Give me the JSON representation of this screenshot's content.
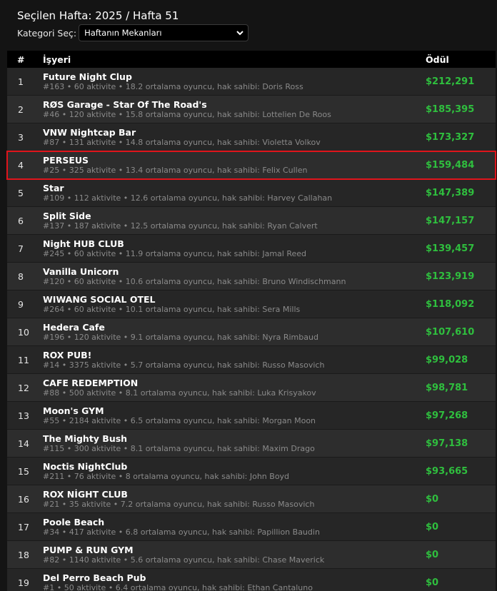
{
  "header": {
    "week_title": "Seçilen Hafta: 2025 / Hafta 51",
    "category_label": "Kategori Seç:",
    "category_selected": "Haftanın Mekanları"
  },
  "table": {
    "columns": {
      "rank": "#",
      "business": "İşyeri",
      "prize": "Ödül"
    },
    "highlight_color": "#e0141b",
    "prize_color": "#2fbf3e",
    "rows": [
      {
        "rank": "1",
        "name": "Future Night Clup",
        "meta": "#163 • 60 aktivite • 18.2 ortalama oyuncu, hak sahibi: Doris Ross",
        "prize": "$212,291"
      },
      {
        "rank": "2",
        "name": "RØS Garage - Star Of The Road's",
        "meta": "#46 • 120 aktivite • 15.8 ortalama oyuncu, hak sahibi: Lottelien De Roos",
        "prize": "$185,395"
      },
      {
        "rank": "3",
        "name": "VNW Nightcap Bar",
        "meta": "#87 • 131 aktivite • 14.8 ortalama oyuncu, hak sahibi: Violetta Volkov",
        "prize": "$173,327"
      },
      {
        "rank": "4",
        "name": "PERSEUS",
        "meta": "#25 • 325 aktivite • 13.4 ortalama oyuncu, hak sahibi: Felix Cullen",
        "prize": "$159,484"
      },
      {
        "rank": "5",
        "name": "Star",
        "meta": "#109 • 112 aktivite • 12.6 ortalama oyuncu, hak sahibi: Harvey Callahan",
        "prize": "$147,389"
      },
      {
        "rank": "6",
        "name": "Split Side",
        "meta": "#137 • 187 aktivite • 12.5 ortalama oyuncu, hak sahibi: Ryan Calvert",
        "prize": "$147,157"
      },
      {
        "rank": "7",
        "name": "Night HUB CLUB",
        "meta": "#245 • 60 aktivite • 11.9 ortalama oyuncu, hak sahibi: Jamal Reed",
        "prize": "$139,457"
      },
      {
        "rank": "8",
        "name": "Vanilla Unicorn",
        "meta": "#120 • 60 aktivite • 10.6 ortalama oyuncu, hak sahibi: Bruno Windischmann",
        "prize": "$123,919"
      },
      {
        "rank": "9",
        "name": "WIWANG SOCIAL OTEL",
        "meta": "#264 • 60 aktivite • 10.1 ortalama oyuncu, hak sahibi: Sera Mills",
        "prize": "$118,092"
      },
      {
        "rank": "10",
        "name": "Hedera Cafe",
        "meta": "#196 • 120 aktivite • 9.1 ortalama oyuncu, hak sahibi: Nyra Rimbaud",
        "prize": "$107,610"
      },
      {
        "rank": "11",
        "name": "ROX PUB!",
        "meta": "#14 • 3375 aktivite • 5.7 ortalama oyuncu, hak sahibi: Russo Masovich",
        "prize": "$99,028"
      },
      {
        "rank": "12",
        "name": "CAFE REDEMPTION",
        "meta": "#88 • 500 aktivite • 8.1 ortalama oyuncu, hak sahibi: Luka Krisyakov",
        "prize": "$98,781"
      },
      {
        "rank": "13",
        "name": "Moon's GYM",
        "meta": "#55 • 2184 aktivite • 6.5 ortalama oyuncu, hak sahibi: Morgan Moon",
        "prize": "$97,268"
      },
      {
        "rank": "14",
        "name": "The Mighty Bush",
        "meta": "#115 • 300 aktivite • 8.1 ortalama oyuncu, hak sahibi: Maxim Drago",
        "prize": "$97,138"
      },
      {
        "rank": "15",
        "name": "Noctis NightClub",
        "meta": "#211 • 76 aktivite • 8 ortalama oyuncu, hak sahibi: John Boyd",
        "prize": "$93,665"
      },
      {
        "rank": "16",
        "name": "ROX NİGHT CLUB",
        "meta": "#21 • 35 aktivite • 7.2 ortalama oyuncu, hak sahibi: Russo Masovich",
        "prize": "$0"
      },
      {
        "rank": "17",
        "name": "Poole Beach",
        "meta": "#34 • 417 aktivite • 6.8 ortalama oyuncu, hak sahibi: Papillion Baudin",
        "prize": "$0"
      },
      {
        "rank": "18",
        "name": "PUMP & RUN GYM",
        "meta": "#82 • 1140 aktivite • 5.6 ortalama oyuncu, hak sahibi: Chase Maverick",
        "prize": "$0"
      },
      {
        "rank": "19",
        "name": "Del Perro Beach Pub",
        "meta": "#1 • 50 aktivite • 6.4 ortalama oyuncu, hak sahibi: Ethan Cantaluno",
        "prize": "$0"
      }
    ]
  }
}
